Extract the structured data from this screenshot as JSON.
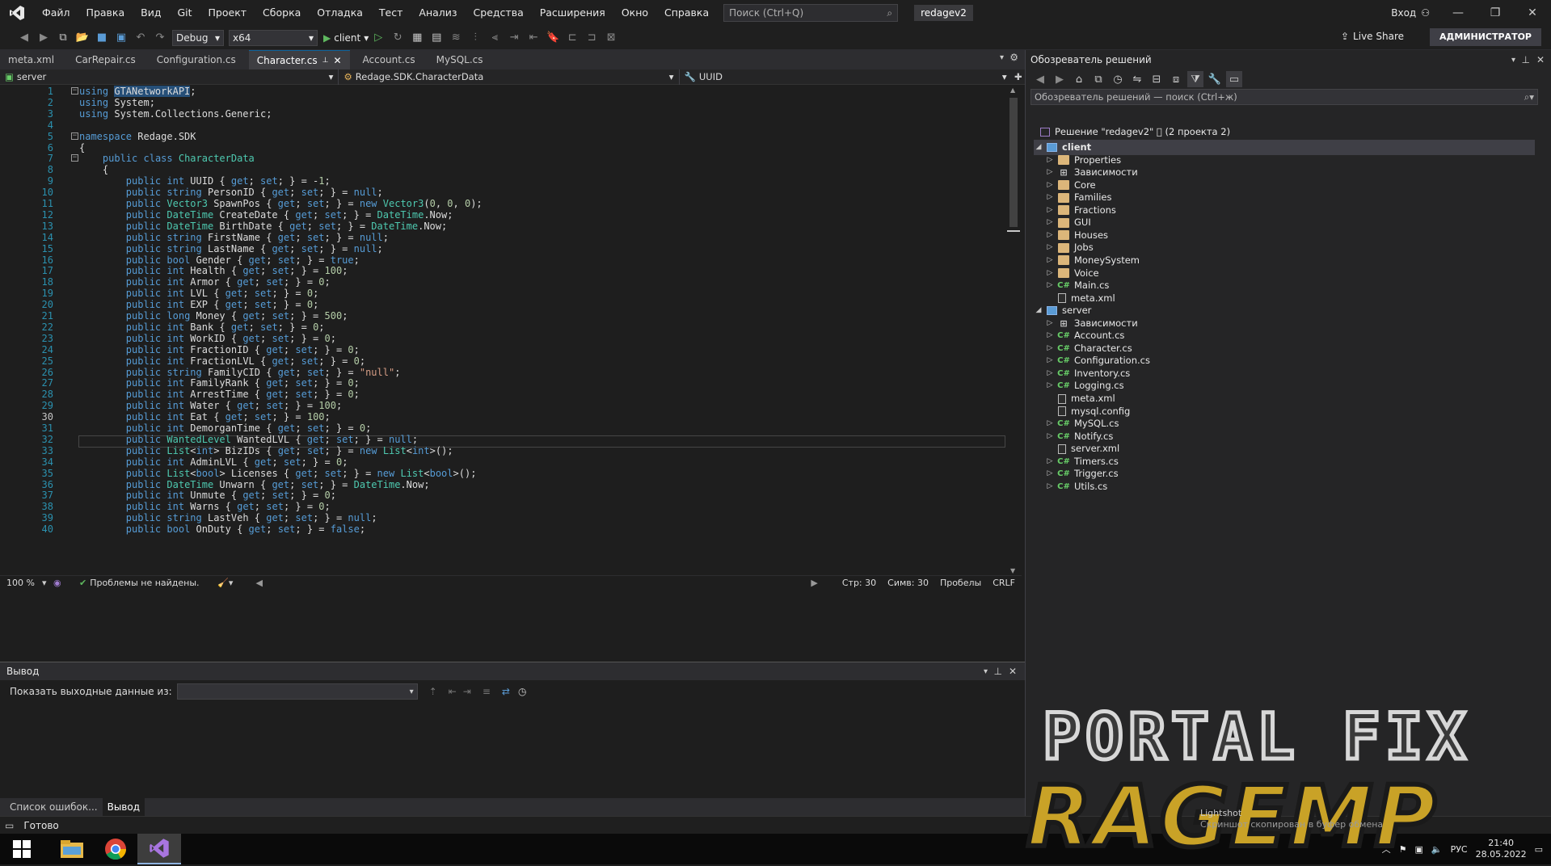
{
  "menubar": {
    "items": [
      "Файл",
      "Правка",
      "Вид",
      "Git",
      "Проект",
      "Сборка",
      "Отладка",
      "Тест",
      "Анализ",
      "Средства",
      "Расширения",
      "Окно",
      "Справка"
    ],
    "search_placeholder": "Поиск (Ctrl+Q)",
    "solution_title": "redagev2",
    "signin": "Вход"
  },
  "toolbar": {
    "config": "Debug",
    "platform": "x64",
    "run_target": "client",
    "liveshare": "Live Share",
    "admin": "АДМИНИСТРАТОР"
  },
  "tabs": [
    {
      "label": "meta.xml"
    },
    {
      "label": "CarRepair.cs"
    },
    {
      "label": "Configuration.cs"
    },
    {
      "label": "Character.cs",
      "active": true
    },
    {
      "label": "Account.cs"
    },
    {
      "label": "MySQL.cs"
    }
  ],
  "navbar": {
    "project": "server",
    "type": "Redage.SDK.CharacterData",
    "member": "UUID"
  },
  "code": {
    "current_line": 30,
    "lines": [
      "using GTANetworkAPI;",
      "using System;",
      "using System.Collections.Generic;",
      "",
      "namespace Redage.SDK",
      "{",
      "    public class CharacterData",
      "    {",
      "        public int UUID { get; set; } = -1;",
      "        public string PersonID { get; set; } = null;",
      "        public Vector3 SpawnPos { get; set; } = new Vector3(0, 0, 0);",
      "        public DateTime CreateDate { get; set; } = DateTime.Now;",
      "        public DateTime BirthDate { get; set; } = DateTime.Now;",
      "        public string FirstName { get; set; } = null;",
      "        public string LastName { get; set; } = null;",
      "        public bool Gender { get; set; } = true;",
      "        public int Health { get; set; } = 100;",
      "        public int Armor { get; set; } = 0;",
      "        public int LVL { get; set; } = 0;",
      "        public int EXP { get; set; } = 0;",
      "        public long Money { get; set; } = 500;",
      "        public int Bank { get; set; } = 0;",
      "        public int WorkID { get; set; } = 0;",
      "        public int FractionID { get; set; } = 0;",
      "        public int FractionLVL { get; set; } = 0;",
      "        public string FamilyCID { get; set; } = \"null\";",
      "        public int FamilyRank { get; set; } = 0;",
      "        public int ArrestTime { get; set; } = 0;",
      "        public int Water { get; set; } = 100;",
      "        public int Eat { get; set; } = 100;",
      "        public int DemorganTime { get; set; } = 0;",
      "        public WantedLevel WantedLVL { get; set; } = null;",
      "        public List<int> BizIDs { get; set; } = new List<int>();",
      "        public int AdminLVL { get; set; } = 0;",
      "        public List<bool> Licenses { get; set; } = new List<bool>();",
      "        public DateTime Unwarn { get; set; } = DateTime.Now;",
      "        public int Unmute { get; set; } = 0;",
      "        public int Warns { get; set; } = 0;",
      "        public string LastVeh { get; set; } = null;",
      "        public bool OnDuty { get; set; } = false;"
    ]
  },
  "editor_status": {
    "zoom": "100 %",
    "issues": "Проблемы не найдены.",
    "line": "Стр: 30",
    "col": "Симв: 30",
    "spaces": "Пробелы",
    "eol": "CRLF"
  },
  "output": {
    "title": "Вывод",
    "show_from": "Показать выходные данные из:"
  },
  "bottom_tabs": [
    "Список ошибок...",
    "Вывод"
  ],
  "solution": {
    "title": "Обозреватель решений",
    "search": "Обозреватель решений — поиск (Ctrl+ж)",
    "root": "Решение \"redagev2\" \u0000 (2 проекта 2)",
    "nodes": [
      {
        "label": "client",
        "level": 0,
        "icon": "proj",
        "arrow": "open",
        "bold": true
      },
      {
        "label": "Properties",
        "level": 1,
        "icon": "folder",
        "arrow": "closed"
      },
      {
        "label": "Зависимости",
        "level": 1,
        "icon": "dep",
        "arrow": "closed"
      },
      {
        "label": "Core",
        "level": 1,
        "icon": "folder",
        "arrow": "closed"
      },
      {
        "label": "Families",
        "level": 1,
        "icon": "folder",
        "arrow": "closed"
      },
      {
        "label": "Fractions",
        "level": 1,
        "icon": "folder",
        "arrow": "closed"
      },
      {
        "label": "GUI",
        "level": 1,
        "icon": "folder",
        "arrow": "closed"
      },
      {
        "label": "Houses",
        "level": 1,
        "icon": "folder",
        "arrow": "closed"
      },
      {
        "label": "Jobs",
        "level": 1,
        "icon": "folder",
        "arrow": "closed"
      },
      {
        "label": "MoneySystem",
        "level": 1,
        "icon": "folder",
        "arrow": "closed"
      },
      {
        "label": "Voice",
        "level": 1,
        "icon": "folder",
        "arrow": "closed"
      },
      {
        "label": "Main.cs",
        "level": 1,
        "icon": "cs",
        "arrow": "closed"
      },
      {
        "label": "meta.xml",
        "level": 1,
        "icon": "doc",
        "arrow": "none"
      },
      {
        "label": "server",
        "level": 0,
        "icon": "proj",
        "arrow": "open"
      },
      {
        "label": "Зависимости",
        "level": 1,
        "icon": "dep",
        "arrow": "closed"
      },
      {
        "label": "Account.cs",
        "level": 1,
        "icon": "cs",
        "arrow": "closed"
      },
      {
        "label": "Character.cs",
        "level": 1,
        "icon": "cs",
        "arrow": "closed"
      },
      {
        "label": "Configuration.cs",
        "level": 1,
        "icon": "cs",
        "arrow": "closed"
      },
      {
        "label": "Inventory.cs",
        "level": 1,
        "icon": "cs",
        "arrow": "closed"
      },
      {
        "label": "Logging.cs",
        "level": 1,
        "icon": "cs",
        "arrow": "closed"
      },
      {
        "label": "meta.xml",
        "level": 1,
        "icon": "doc",
        "arrow": "none"
      },
      {
        "label": "mysql.config",
        "level": 1,
        "icon": "doc",
        "arrow": "none"
      },
      {
        "label": "MySQL.cs",
        "level": 1,
        "icon": "cs",
        "arrow": "closed"
      },
      {
        "label": "Notify.cs",
        "level": 1,
        "icon": "cs",
        "arrow": "closed"
      },
      {
        "label": "server.xml",
        "level": 1,
        "icon": "doc",
        "arrow": "none"
      },
      {
        "label": "Timers.cs",
        "level": 1,
        "icon": "cs",
        "arrow": "closed"
      },
      {
        "label": "Trigger.cs",
        "level": 1,
        "icon": "cs",
        "arrow": "closed"
      },
      {
        "label": "Utils.cs",
        "level": 1,
        "icon": "cs",
        "arrow": "closed"
      }
    ]
  },
  "statusbar": {
    "ready": "Готово"
  },
  "taskbar": {
    "lang": "РУС",
    "time": "21:40",
    "date": "28.05.2022"
  },
  "watermark": {
    "line1": "PORTAL FIX",
    "line2": "RAGEMP"
  },
  "toast": {
    "app": "Lightshot",
    "message": "Скриншот скопирован в буфер обмена"
  },
  "colors": {
    "accent": "#0e639c",
    "keyword": "#569cd6",
    "type": "#4ec9b0",
    "string": "#d69d85",
    "number": "#b5cea8",
    "linenum": "#2b91af"
  }
}
